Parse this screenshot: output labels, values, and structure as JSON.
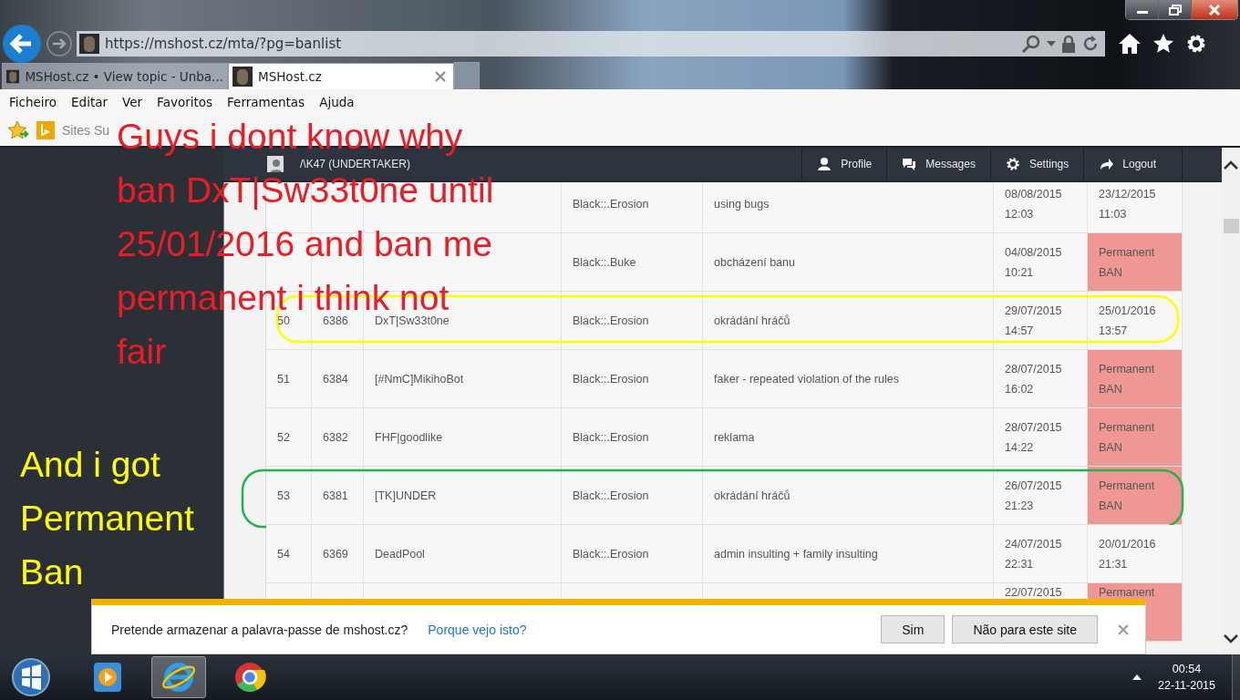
{
  "browser": {
    "url": "https://mshost.cz/mta/?pg=banlist",
    "tabs": [
      {
        "label": "MSHost.cz • View topic - Unba...",
        "selected": false
      },
      {
        "label": "MSHost.cz",
        "selected": true
      }
    ],
    "menu": [
      "Ficheiro",
      "Editar",
      "Ver",
      "Favoritos",
      "Ferramentas",
      "Ajuda"
    ],
    "favorites": [
      {
        "label": "Sites Su"
      }
    ]
  },
  "site_nav": {
    "user": "/\\K47 (UNDERTAKER)",
    "items": [
      {
        "kind": "profile",
        "label": "Profile"
      },
      {
        "kind": "messages",
        "label": "Messages"
      },
      {
        "kind": "settings",
        "label": "Settings"
      },
      {
        "kind": "logout",
        "label": "Logout"
      }
    ]
  },
  "ban_table": {
    "rows": [
      {
        "admin": "Black::.Erosion",
        "reason": "using bugs",
        "banned": "08/08/2015 12:03",
        "expires": "23/12/2015 11:03",
        "permanent": false
      },
      {
        "admin": "Black::.Buke",
        "reason": "obcházení banu",
        "banned": "04/08/2015 10:21",
        "expires": "Permanent BAN",
        "permanent": true
      },
      {
        "num": "50",
        "id": "6386",
        "player": "DxT|Sw33t0ne",
        "admin": "Black::.Erosion",
        "reason": "okrádání hráčů",
        "banned": "29/07/2015 14:57",
        "expires": "25/01/2016 13:57",
        "permanent": false,
        "highlight": {
          "color": "#ffff00"
        }
      },
      {
        "num": "51",
        "id": "6384",
        "player": "[#NmC]MikihoBot",
        "admin": "Black::.Erosion",
        "reason": "faker - repeated violation of the rules",
        "banned": "28/07/2015 16:02",
        "expires": "Permanent BAN",
        "permanent": true
      },
      {
        "num": "52",
        "id": "6382",
        "player": "FHF|goodlike",
        "admin": "Black::.Erosion",
        "reason": "reklama",
        "banned": "28/07/2015 14:22",
        "expires": "Permanent BAN",
        "permanent": true
      },
      {
        "num": "53",
        "id": "6381",
        "player": "[TK]UNDER",
        "admin": "Black::.Erosion",
        "reason": "okrádání hráčů",
        "banned": "26/07/2015 21:23",
        "expires": "Permanent BAN",
        "permanent": true,
        "highlight": {
          "color": "#22b34a"
        }
      },
      {
        "num": "54",
        "id": "6369",
        "player": "DeadPool",
        "admin": "Black::.Erosion",
        "reason": "admin insulting + family insulting",
        "banned": "24/07/2015 22:31",
        "expires": "20/01/2016 21:31",
        "permanent": false
      },
      {
        "banned": "22/07/2015",
        "expires": "Permanent",
        "permanent": true
      }
    ]
  },
  "annotations": [
    {
      "lines": [
        "Guys i dont know why",
        "ban DxT|Sw33t0ne until",
        "25/01/2016 and ban me",
        "permanent i think not",
        "fair"
      ],
      "color": "#ed1c24"
    },
    {
      "lines": [
        "And i got",
        "Permanent",
        "Ban"
      ],
      "color": "#ffff00"
    }
  ],
  "password_prompt": {
    "message": "Pretende armazenar a palavra-passe de mshost.cz?",
    "link": "Porque vejo isto?",
    "buttons": [
      "Sim",
      "Não para este site"
    ]
  },
  "taskbar": {
    "apps": [
      {
        "kind": "media",
        "selected": false
      },
      {
        "kind": "ie",
        "selected": true
      },
      {
        "kind": "chrome",
        "selected": false
      }
    ],
    "time": "00:54",
    "date": "22-11-2015"
  }
}
